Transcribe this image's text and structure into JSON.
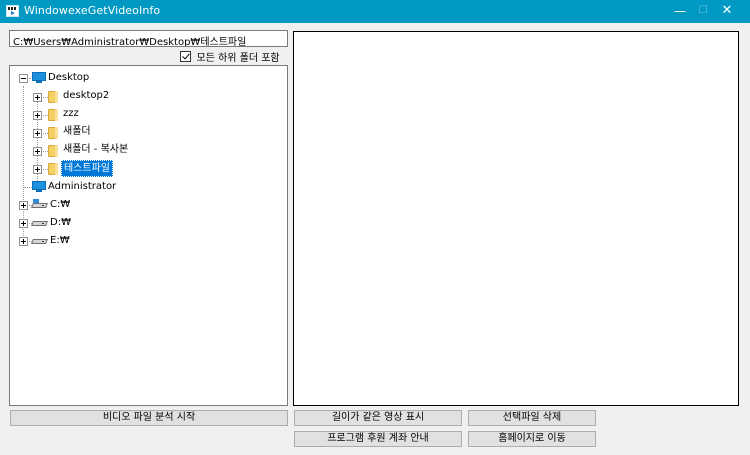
{
  "window": {
    "title": "WindowexeGetVideoInfo",
    "minimize_glyph": "—",
    "maximize_glyph": "☐",
    "close_glyph": "✕"
  },
  "path_field": {
    "value": "C:₩Users₩Administrator₩Desktop₩테스트파일"
  },
  "include_subfolders": {
    "label": "모든 하위 폴더 포함",
    "checked": true
  },
  "tree": {
    "desktop": "Desktop",
    "desktop_children": [
      "desktop2",
      "zzz",
      "새폴더",
      "새폴더 - 복사본",
      "테스트파일"
    ],
    "selected": "테스트파일",
    "administrator": "Administrator",
    "drives": [
      "C:₩",
      "D:₩",
      "E:₩"
    ]
  },
  "buttons": {
    "start_analysis": "비디오 파일 분석 시작",
    "show_same_length": "길이가 같은 영상 표시",
    "delete_selected": "선택파일 삭제",
    "donation_info": "프로그램 후원 계좌 안내",
    "go_homepage": "홈페이지로 이동"
  },
  "colors": {
    "titlebar": "#0099c3",
    "selection": "#0078d7",
    "folder": "#f6cf62"
  }
}
